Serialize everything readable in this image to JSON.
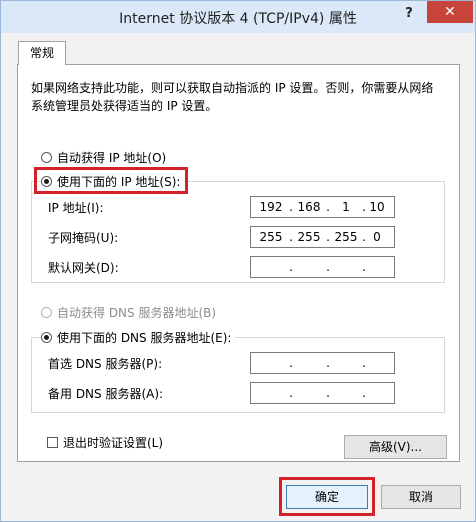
{
  "window": {
    "title": "Internet 协议版本 4 (TCP/IPv4) 属性",
    "help_glyph": "?",
    "close_glyph": "✕"
  },
  "tab": {
    "label": "常规"
  },
  "description": "如果网络支持此功能，则可以获取自动指派的 IP 设置。否则，你需要从网络系统管理员处获得适当的 IP 设置。",
  "ip_section": {
    "auto_label": "自动获得 IP 地址(O)",
    "manual_label": "使用下面的 IP 地址(S):",
    "selected": "manual",
    "fields": [
      {
        "label": "IP 地址(I):",
        "octets": [
          "192",
          "168",
          "1",
          "10"
        ]
      },
      {
        "label": "子网掩码(U):",
        "octets": [
          "255",
          "255",
          "255",
          "0"
        ]
      },
      {
        "label": "默认网关(D):",
        "octets": [
          "",
          "",
          "",
          ""
        ]
      }
    ]
  },
  "dns_section": {
    "auto_label": "自动获得 DNS 服务器地址(B)",
    "manual_label": "使用下面的 DNS 服务器地址(E):",
    "selected": "manual",
    "fields": [
      {
        "label": "首选 DNS 服务器(P):",
        "octets": [
          "",
          "",
          "",
          ""
        ]
      },
      {
        "label": "备用 DNS 服务器(A):",
        "octets": [
          "",
          "",
          "",
          ""
        ]
      }
    ]
  },
  "validate_on_exit": {
    "label": "退出时验证设置(L)",
    "checked": false
  },
  "buttons": {
    "advanced": "高级(V)...",
    "ok": "确定",
    "cancel": "取消"
  },
  "colors": {
    "highlight": "#d3212a",
    "titlebar": "#dae8f7",
    "close": "#c7443b"
  }
}
